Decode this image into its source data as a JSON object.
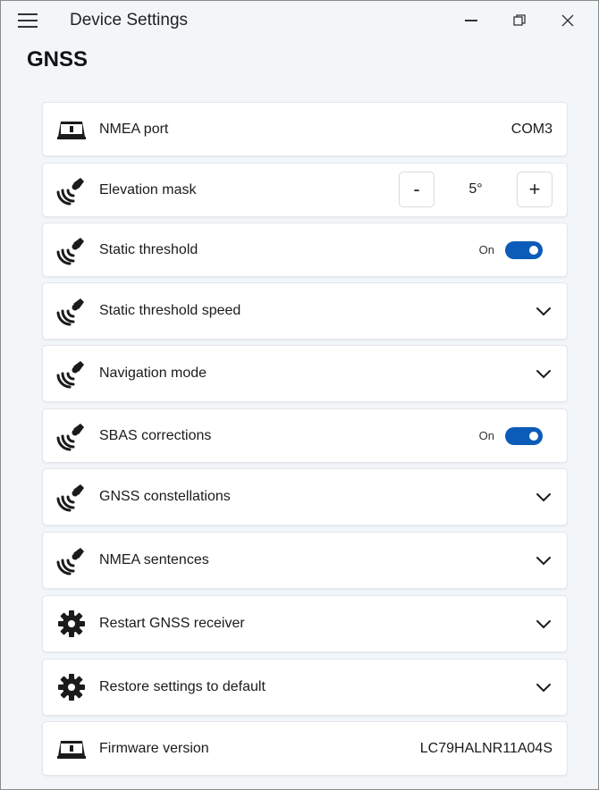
{
  "window": {
    "title": "Device Settings",
    "icons": {
      "menu": "hamburger-icon",
      "minimize": "minimize-icon",
      "maximize": "restore-icon",
      "close": "close-icon"
    }
  },
  "page": {
    "title": "GNSS"
  },
  "colors": {
    "accent": "#0b5cb8",
    "card": "#ffffff",
    "background": "#f3f6f9"
  },
  "settings": [
    {
      "label": "NMEA port",
      "icon": "device-icon",
      "type": "value",
      "value": "COM3"
    },
    {
      "label": "Elevation mask",
      "icon": "satellite-icon",
      "type": "stepper",
      "value": "5°",
      "minus": "-",
      "plus": "+"
    },
    {
      "label": "Static threshold",
      "icon": "satellite-icon",
      "type": "toggle",
      "state": "On"
    },
    {
      "label": "Static threshold speed",
      "icon": "satellite-icon",
      "type": "expander"
    },
    {
      "label": "Navigation mode",
      "icon": "satellite-icon",
      "type": "expander"
    },
    {
      "label": "SBAS corrections",
      "icon": "satellite-icon",
      "type": "toggle",
      "state": "On"
    },
    {
      "label": "GNSS constellations",
      "icon": "satellite-icon",
      "type": "expander"
    },
    {
      "label": "NMEA sentences",
      "icon": "satellite-icon",
      "type": "expander"
    },
    {
      "label": "Restart GNSS receiver",
      "icon": "gear-icon",
      "type": "expander"
    },
    {
      "label": "Restore settings to default",
      "icon": "gear-icon",
      "type": "expander"
    },
    {
      "label": "Firmware version",
      "icon": "device-icon",
      "type": "value",
      "value": "LC79HALNR11A04S"
    }
  ]
}
